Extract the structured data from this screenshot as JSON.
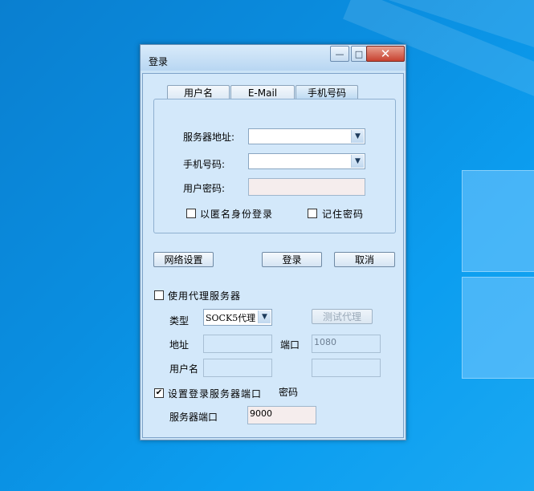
{
  "window": {
    "title": "登录",
    "minimize_glyph": "—",
    "maximize_glyph": "□",
    "close_glyph": "✕"
  },
  "tabs": [
    {
      "label": "用户名"
    },
    {
      "label": "E-Mail"
    },
    {
      "label": "手机号码"
    }
  ],
  "login_group": {
    "server_label": "服务器地址:",
    "server_value": "",
    "phone_label": "手机号码:",
    "phone_value": "",
    "password_label": "用户密码:",
    "password_value": "",
    "anonymous_label": "以匿名身份登录",
    "anonymous_checked": false,
    "remember_label": "记住密码",
    "remember_checked": false
  },
  "buttons": {
    "network_settings": "网络设置",
    "login": "登录",
    "cancel": "取消"
  },
  "proxy": {
    "use_proxy_label": "使用代理服务器",
    "use_proxy_checked": false,
    "type_label": "类型",
    "type_value": "SOCK5代理",
    "test_proxy_button": "测试代理",
    "address_label": "地址",
    "address_value": "",
    "port_label": "端口",
    "port_value": "1080",
    "username_label": "用户名",
    "username_value": "",
    "password_label": "密码",
    "password_value": ""
  },
  "server_port": {
    "set_port_label": "设置登录服务器端口",
    "set_port_checked": true,
    "port_label": "服务器端口",
    "port_value": "9000"
  },
  "icons": {
    "dropdown_arrow": "chevron-down-icon",
    "check_mark": "✔"
  }
}
